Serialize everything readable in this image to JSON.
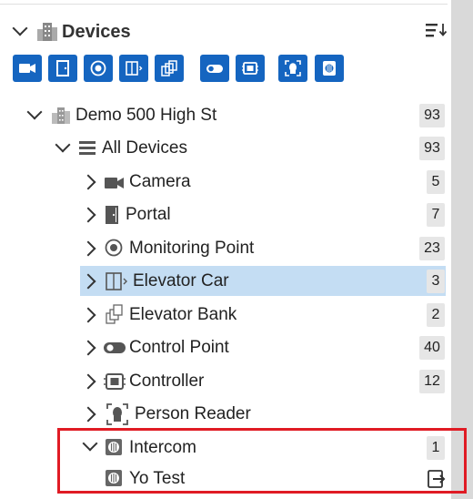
{
  "panel": {
    "title": "Devices",
    "icons": {
      "header": "building-icon",
      "sort": "sort-icon"
    }
  },
  "filters": [
    {
      "name": "camera-filter-button",
      "icon": "camera-icon"
    },
    {
      "name": "portal-filter-button",
      "icon": "door-icon"
    },
    {
      "name": "monitoring-point-filter-button",
      "icon": "target-icon"
    },
    {
      "name": "elevator-car-filter-button",
      "icon": "elevator-car-icon"
    },
    {
      "name": "elevator-bank-filter-button",
      "icon": "elevator-bank-icon"
    },
    {
      "name": "control-point-filter-button",
      "icon": "toggle-icon"
    },
    {
      "name": "controller-filter-button",
      "icon": "chip-icon"
    },
    {
      "name": "person-reader-filter-button",
      "icon": "face-scan-icon"
    },
    {
      "name": "intercom-filter-button",
      "icon": "intercom-icon"
    }
  ],
  "tree": {
    "site": {
      "label": "Demo 500 High St",
      "count": "93",
      "expanded": true,
      "icon": "building-icon"
    },
    "all": {
      "label": "All Devices",
      "count": "93",
      "expanded": true,
      "icon": "list-icon"
    },
    "types": [
      {
        "label": "Camera",
        "count": "5",
        "icon": "camera-icon"
      },
      {
        "label": "Portal",
        "count": "7",
        "icon": "door-icon"
      },
      {
        "label": "Monitoring Point",
        "count": "23",
        "icon": "target-icon"
      },
      {
        "label": "Elevator Car",
        "count": "3",
        "icon": "elevator-car-icon",
        "selected": true
      },
      {
        "label": "Elevator Bank",
        "count": "2",
        "icon": "elevator-bank-icon"
      },
      {
        "label": "Control Point",
        "count": "40",
        "icon": "toggle-icon"
      },
      {
        "label": "Controller",
        "count": "12",
        "icon": "chip-icon"
      },
      {
        "label": "Person Reader",
        "count": "",
        "icon": "face-scan-icon"
      },
      {
        "label": "Intercom",
        "count": "1",
        "icon": "intercom-icon",
        "expanded": true
      }
    ],
    "device": {
      "label": "Yo Test",
      "icon": "intercom-icon",
      "action_icon": "open-in-icon"
    }
  },
  "colors": {
    "accent": "#1565c0",
    "selected_row": "#c4ddf3",
    "highlight": "#e01b24",
    "count_bg": "#e6e6e6"
  }
}
